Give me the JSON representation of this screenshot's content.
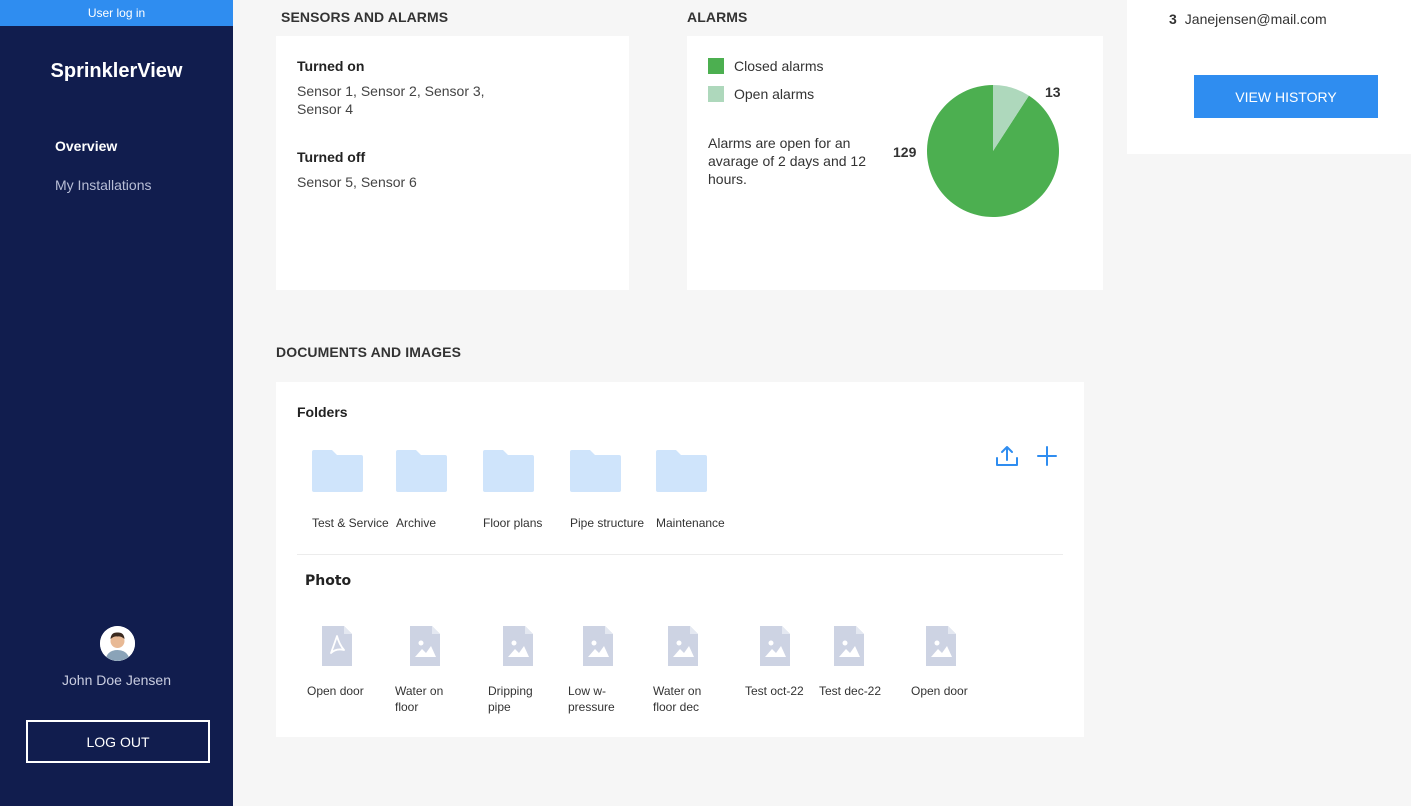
{
  "sidebar": {
    "banner": "User log in",
    "brand": "SprinklerView",
    "nav": [
      {
        "label": "Overview",
        "active": true
      },
      {
        "label": "My Installations",
        "active": false
      }
    ],
    "user_name": "John Doe Jensen",
    "logout_label": "LOG OUT"
  },
  "sensors": {
    "title": "SENSORS AND ALARMS",
    "on_label": "Turned on",
    "on_value": "Sensor 1, Sensor 2, Sensor 3, Sensor 4",
    "off_label": "Turned off",
    "off_value": "Sensor 5, Sensor 6"
  },
  "alarms": {
    "title": "ALARMS",
    "legend": [
      {
        "label": "Closed alarms",
        "color": "#4caf50"
      },
      {
        "label": "Open alarms",
        "color": "#aed8bc"
      }
    ],
    "note": "Alarms are open for an avarage of 2 days and 12 hours.",
    "closed_count": "129",
    "open_count": "13"
  },
  "chart_data": {
    "type": "pie",
    "categories": [
      "Closed alarms",
      "Open alarms"
    ],
    "values": [
      129,
      13
    ],
    "colors": [
      "#4caf50",
      "#aed8bc"
    ],
    "legend": "top-left"
  },
  "history": {
    "number": "3",
    "email": "Janejensen@mail.com",
    "button_label": "VIEW HISTORY"
  },
  "documents": {
    "title": "DOCUMENTS AND IMAGES",
    "folders_title": "Folders",
    "folders": [
      {
        "label": "Test & Service"
      },
      {
        "label": "Archive"
      },
      {
        "label": "Floor plans"
      },
      {
        "label": "Pipe structure"
      },
      {
        "label": "Maintenance"
      }
    ],
    "photo_title": "Photo",
    "photos": [
      {
        "label": "Open door",
        "icon": "pdf-file-icon"
      },
      {
        "label": "Water on floor",
        "icon": "image-file-icon"
      },
      {
        "label": "Dripping pipe",
        "icon": "image-file-icon"
      },
      {
        "label": "Low w-pressure",
        "icon": "image-file-icon"
      },
      {
        "label": "Water on floor dec",
        "icon": "image-file-icon"
      },
      {
        "label": "Test oct-22",
        "icon": "image-file-icon"
      },
      {
        "label": "Test dec-22",
        "icon": "image-file-icon"
      },
      {
        "label": "Open door",
        "icon": "image-file-icon"
      }
    ]
  }
}
